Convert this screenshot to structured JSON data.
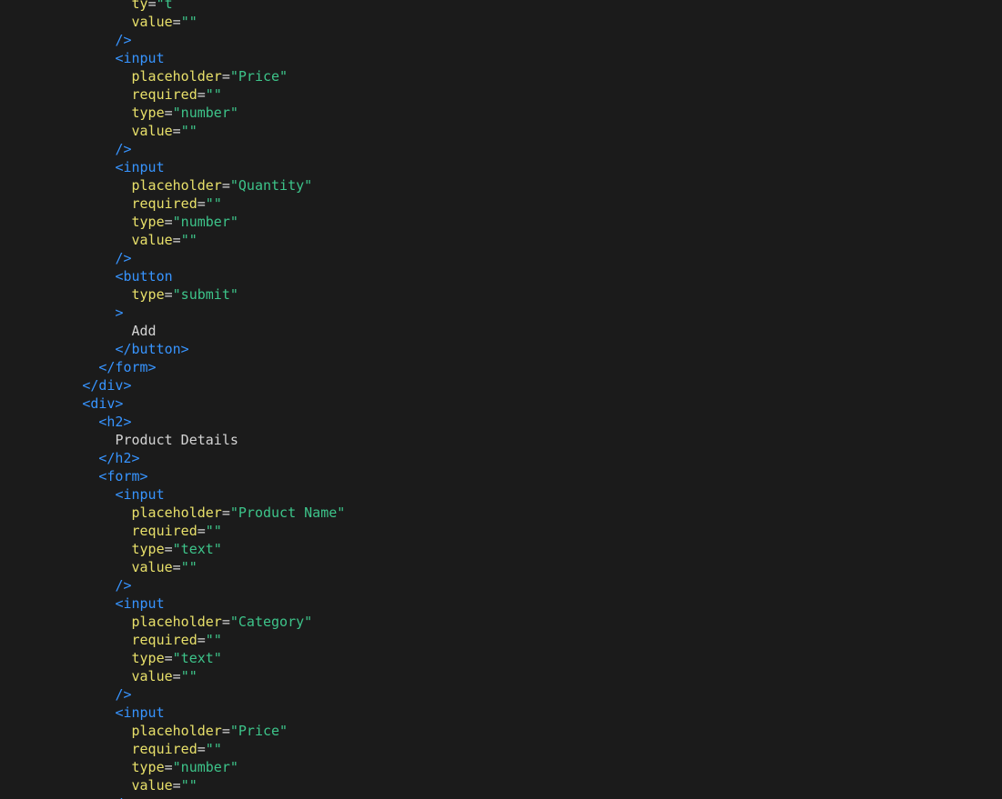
{
  "colors": {
    "background": "#1b1b1b",
    "tag": "#3794ff",
    "attribute": "#e8e06a",
    "string": "#3dc48a",
    "text": "#d4d4d4"
  },
  "lines": [
    {
      "indent": 8,
      "tokens": [
        {
          "k": "attr",
          "t": "ty"
        },
        {
          "k": "eq",
          "t": "="
        },
        {
          "k": "str",
          "t": "\"t"
        }
      ]
    },
    {
      "indent": 8,
      "tokens": [
        {
          "k": "attr",
          "t": "value"
        },
        {
          "k": "eq",
          "t": "="
        },
        {
          "k": "str",
          "t": "\"\""
        }
      ]
    },
    {
      "indent": 7,
      "tokens": [
        {
          "k": "tag",
          "t": "/>"
        }
      ]
    },
    {
      "indent": 7,
      "tokens": [
        {
          "k": "tag",
          "t": "<input"
        }
      ]
    },
    {
      "indent": 8,
      "tokens": [
        {
          "k": "attr",
          "t": "placeholder"
        },
        {
          "k": "eq",
          "t": "="
        },
        {
          "k": "str",
          "t": "\"Price\""
        }
      ]
    },
    {
      "indent": 8,
      "tokens": [
        {
          "k": "attr",
          "t": "required"
        },
        {
          "k": "eq",
          "t": "="
        },
        {
          "k": "str",
          "t": "\"\""
        }
      ]
    },
    {
      "indent": 8,
      "tokens": [
        {
          "k": "attr",
          "t": "type"
        },
        {
          "k": "eq",
          "t": "="
        },
        {
          "k": "str",
          "t": "\"number\""
        }
      ]
    },
    {
      "indent": 8,
      "tokens": [
        {
          "k": "attr",
          "t": "value"
        },
        {
          "k": "eq",
          "t": "="
        },
        {
          "k": "str",
          "t": "\"\""
        }
      ]
    },
    {
      "indent": 7,
      "tokens": [
        {
          "k": "tag",
          "t": "/>"
        }
      ]
    },
    {
      "indent": 7,
      "tokens": [
        {
          "k": "tag",
          "t": "<input"
        }
      ]
    },
    {
      "indent": 8,
      "tokens": [
        {
          "k": "attr",
          "t": "placeholder"
        },
        {
          "k": "eq",
          "t": "="
        },
        {
          "k": "str",
          "t": "\"Quantity\""
        }
      ]
    },
    {
      "indent": 8,
      "tokens": [
        {
          "k": "attr",
          "t": "required"
        },
        {
          "k": "eq",
          "t": "="
        },
        {
          "k": "str",
          "t": "\"\""
        }
      ]
    },
    {
      "indent": 8,
      "tokens": [
        {
          "k": "attr",
          "t": "type"
        },
        {
          "k": "eq",
          "t": "="
        },
        {
          "k": "str",
          "t": "\"number\""
        }
      ]
    },
    {
      "indent": 8,
      "tokens": [
        {
          "k": "attr",
          "t": "value"
        },
        {
          "k": "eq",
          "t": "="
        },
        {
          "k": "str",
          "t": "\"\""
        }
      ]
    },
    {
      "indent": 7,
      "tokens": [
        {
          "k": "tag",
          "t": "/>"
        }
      ]
    },
    {
      "indent": 7,
      "tokens": [
        {
          "k": "tag",
          "t": "<button"
        }
      ]
    },
    {
      "indent": 8,
      "tokens": [
        {
          "k": "attr",
          "t": "type"
        },
        {
          "k": "eq",
          "t": "="
        },
        {
          "k": "str",
          "t": "\"submit\""
        }
      ]
    },
    {
      "indent": 7,
      "tokens": [
        {
          "k": "tag",
          "t": ">"
        }
      ]
    },
    {
      "indent": 8,
      "tokens": [
        {
          "k": "text",
          "t": "Add"
        }
      ]
    },
    {
      "indent": 7,
      "tokens": [
        {
          "k": "tag",
          "t": "</button>"
        }
      ]
    },
    {
      "indent": 6,
      "tokens": [
        {
          "k": "tag",
          "t": "</form>"
        }
      ]
    },
    {
      "indent": 5,
      "tokens": [
        {
          "k": "tag",
          "t": "</div>"
        }
      ]
    },
    {
      "indent": 5,
      "tokens": [
        {
          "k": "tag",
          "t": "<div>"
        }
      ]
    },
    {
      "indent": 6,
      "tokens": [
        {
          "k": "tag",
          "t": "<h2>"
        }
      ]
    },
    {
      "indent": 7,
      "tokens": [
        {
          "k": "text",
          "t": "Product Details"
        }
      ]
    },
    {
      "indent": 6,
      "tokens": [
        {
          "k": "tag",
          "t": "</h2>"
        }
      ]
    },
    {
      "indent": 6,
      "tokens": [
        {
          "k": "tag",
          "t": "<form>"
        }
      ]
    },
    {
      "indent": 7,
      "tokens": [
        {
          "k": "tag",
          "t": "<input"
        }
      ]
    },
    {
      "indent": 8,
      "tokens": [
        {
          "k": "attr",
          "t": "placeholder"
        },
        {
          "k": "eq",
          "t": "="
        },
        {
          "k": "str",
          "t": "\"Product Name\""
        }
      ]
    },
    {
      "indent": 8,
      "tokens": [
        {
          "k": "attr",
          "t": "required"
        },
        {
          "k": "eq",
          "t": "="
        },
        {
          "k": "str",
          "t": "\"\""
        }
      ]
    },
    {
      "indent": 8,
      "tokens": [
        {
          "k": "attr",
          "t": "type"
        },
        {
          "k": "eq",
          "t": "="
        },
        {
          "k": "str",
          "t": "\"text\""
        }
      ]
    },
    {
      "indent": 8,
      "tokens": [
        {
          "k": "attr",
          "t": "value"
        },
        {
          "k": "eq",
          "t": "="
        },
        {
          "k": "str",
          "t": "\"\""
        }
      ]
    },
    {
      "indent": 7,
      "tokens": [
        {
          "k": "tag",
          "t": "/>"
        }
      ]
    },
    {
      "indent": 7,
      "tokens": [
        {
          "k": "tag",
          "t": "<input"
        }
      ]
    },
    {
      "indent": 8,
      "tokens": [
        {
          "k": "attr",
          "t": "placeholder"
        },
        {
          "k": "eq",
          "t": "="
        },
        {
          "k": "str",
          "t": "\"Category\""
        }
      ]
    },
    {
      "indent": 8,
      "tokens": [
        {
          "k": "attr",
          "t": "required"
        },
        {
          "k": "eq",
          "t": "="
        },
        {
          "k": "str",
          "t": "\"\""
        }
      ]
    },
    {
      "indent": 8,
      "tokens": [
        {
          "k": "attr",
          "t": "type"
        },
        {
          "k": "eq",
          "t": "="
        },
        {
          "k": "str",
          "t": "\"text\""
        }
      ]
    },
    {
      "indent": 8,
      "tokens": [
        {
          "k": "attr",
          "t": "value"
        },
        {
          "k": "eq",
          "t": "="
        },
        {
          "k": "str",
          "t": "\"\""
        }
      ]
    },
    {
      "indent": 7,
      "tokens": [
        {
          "k": "tag",
          "t": "/>"
        }
      ]
    },
    {
      "indent": 7,
      "tokens": [
        {
          "k": "tag",
          "t": "<input"
        }
      ]
    },
    {
      "indent": 8,
      "tokens": [
        {
          "k": "attr",
          "t": "placeholder"
        },
        {
          "k": "eq",
          "t": "="
        },
        {
          "k": "str",
          "t": "\"Price\""
        }
      ]
    },
    {
      "indent": 8,
      "tokens": [
        {
          "k": "attr",
          "t": "required"
        },
        {
          "k": "eq",
          "t": "="
        },
        {
          "k": "str",
          "t": "\"\""
        }
      ]
    },
    {
      "indent": 8,
      "tokens": [
        {
          "k": "attr",
          "t": "type"
        },
        {
          "k": "eq",
          "t": "="
        },
        {
          "k": "str",
          "t": "\"number\""
        }
      ]
    },
    {
      "indent": 8,
      "tokens": [
        {
          "k": "attr",
          "t": "value"
        },
        {
          "k": "eq",
          "t": "="
        },
        {
          "k": "str",
          "t": "\"\""
        }
      ]
    },
    {
      "indent": 7,
      "tokens": [
        {
          "k": "tag",
          "t": "/>"
        }
      ]
    }
  ]
}
